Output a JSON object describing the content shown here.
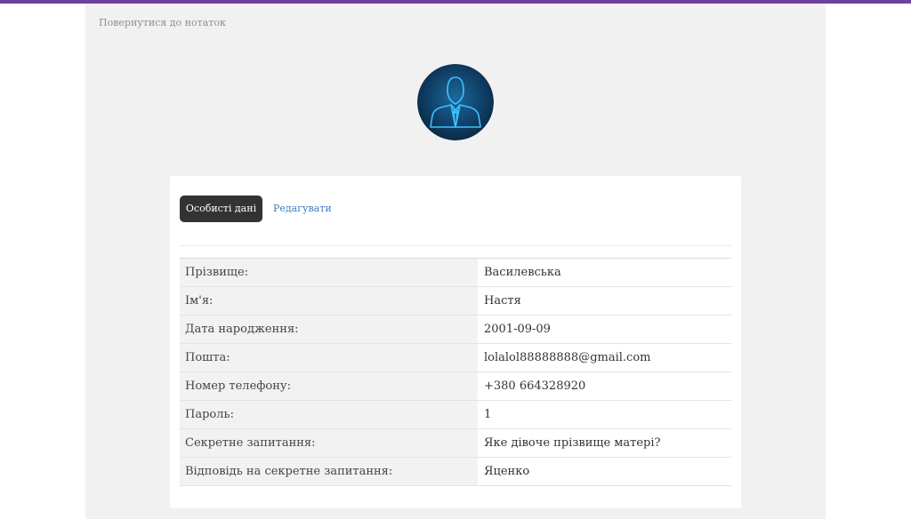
{
  "nav": {
    "back_label": "Повернутися до нотаток"
  },
  "profile": {
    "avatar_icon": "user-avatar-icon",
    "tabs": {
      "personal": "Особисті дані",
      "edit": "Редагувати"
    },
    "fields": [
      {
        "label": "Прізвище:",
        "value": "Василевська"
      },
      {
        "label": "Ім'я:",
        "value": "Настя"
      },
      {
        "label": "Дата народження:",
        "value": "2001-09-09"
      },
      {
        "label": "Пошта:",
        "value": "lolalol88888888@gmail.com"
      },
      {
        "label": "Номер телефону:",
        "value": "+380 664328920"
      },
      {
        "label": "Пароль:",
        "value": "1"
      },
      {
        "label": "Секретне запитання:",
        "value": "Яке дівоче прізвище матері?"
      },
      {
        "label": "Відповідь на секретне запитання:",
        "value": "Яценко"
      }
    ]
  },
  "colors": {
    "top_bar": "#6f3f9c",
    "panel_bg": "#f1f1f1",
    "active_tab": "#333333",
    "link": "#3f7fc2"
  }
}
